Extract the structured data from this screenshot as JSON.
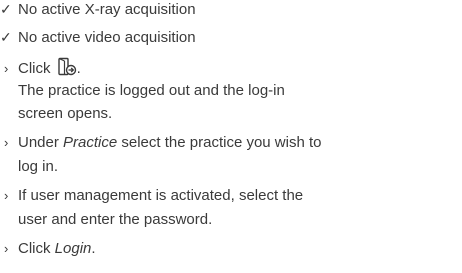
{
  "prerequisites": [
    {
      "marker": "✓",
      "text": "No active X-ray acquisition"
    },
    {
      "marker": "✓",
      "text": "No active video acquisition"
    }
  ],
  "steps": {
    "marker": "›",
    "step1": {
      "prefix": "Click",
      "icon": "logout-icon",
      "suffix": ".",
      "result_line1": "The practice is logged out and the log-in",
      "result_line2": "screen opens."
    },
    "step2": {
      "prefix": "Under ",
      "emphasis": "Practice",
      "line1_rest": " select the practice you wish to",
      "line2": "log in."
    },
    "step3": {
      "line1": "If user management is activated, select the",
      "line2": "user and enter the password."
    },
    "step4": {
      "prefix": "Click ",
      "emphasis": "Login",
      "suffix": "."
    }
  }
}
